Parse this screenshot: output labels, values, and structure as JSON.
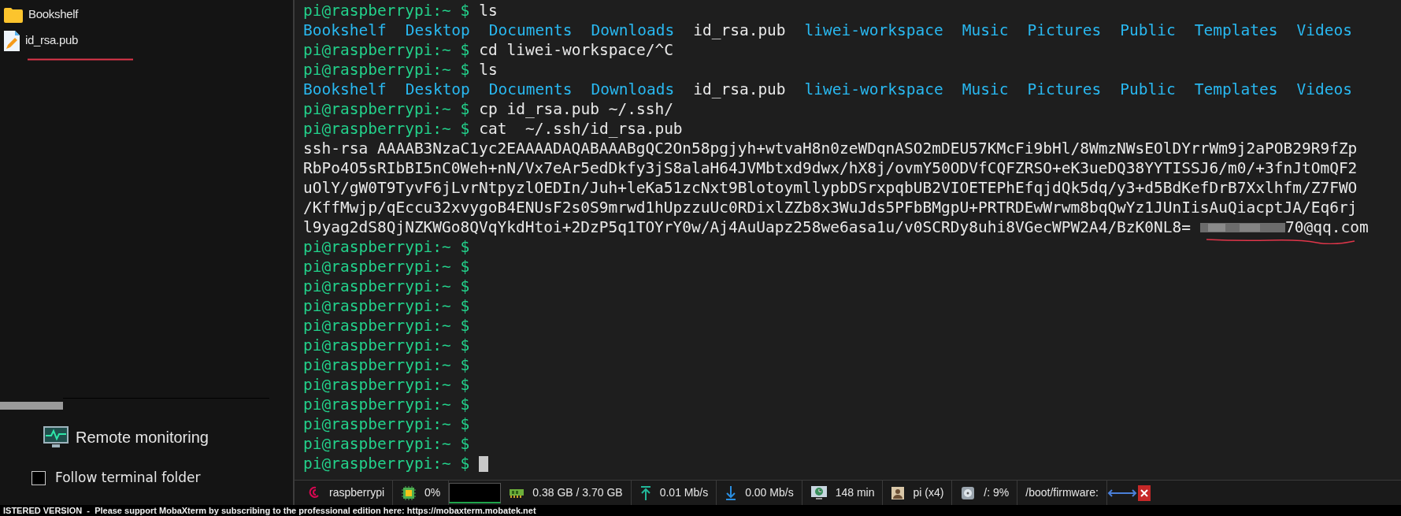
{
  "sidebar": {
    "files": [
      {
        "name": "Bookshelf",
        "kind": "folder"
      },
      {
        "name": "id_rsa.pub",
        "kind": "file"
      }
    ],
    "remote_monitoring": "Remote monitoring",
    "follow_checkbox": {
      "label": "Follow terminal folder",
      "checked": false
    }
  },
  "terminal": {
    "lines": [
      {
        "kind": "command",
        "prompt": "pi@raspberrypi:~ $",
        "text": "ls"
      },
      {
        "kind": "listing",
        "entries": [
          {
            "name": "Bookshelf",
            "kind": "dir"
          },
          {
            "name": "Desktop",
            "kind": "dir"
          },
          {
            "name": "Documents",
            "kind": "dir"
          },
          {
            "name": "Downloads",
            "kind": "dir"
          },
          {
            "name": "id_rsa.pub",
            "kind": "file"
          },
          {
            "name": "liwei-workspace",
            "kind": "dir"
          },
          {
            "name": "Music",
            "kind": "dir"
          },
          {
            "name": "Pictures",
            "kind": "dir"
          },
          {
            "name": "Public",
            "kind": "dir"
          },
          {
            "name": "Templates",
            "kind": "dir"
          },
          {
            "name": "Videos",
            "kind": "dir"
          }
        ]
      },
      {
        "kind": "command",
        "prompt": "pi@raspberrypi:~ $",
        "text": "cd liwei-workspace/^C"
      },
      {
        "kind": "command",
        "prompt": "pi@raspberrypi:~ $",
        "text": "ls"
      },
      {
        "kind": "listing",
        "entries": [
          {
            "name": "Bookshelf",
            "kind": "dir"
          },
          {
            "name": "Desktop",
            "kind": "dir"
          },
          {
            "name": "Documents",
            "kind": "dir"
          },
          {
            "name": "Downloads",
            "kind": "dir"
          },
          {
            "name": "id_rsa.pub",
            "kind": "file"
          },
          {
            "name": "liwei-workspace",
            "kind": "dir"
          },
          {
            "name": "Music",
            "kind": "dir"
          },
          {
            "name": "Pictures",
            "kind": "dir"
          },
          {
            "name": "Public",
            "kind": "dir"
          },
          {
            "name": "Templates",
            "kind": "dir"
          },
          {
            "name": "Videos",
            "kind": "dir"
          }
        ]
      },
      {
        "kind": "command",
        "prompt": "pi@raspberrypi:~ $",
        "text": "cp id_rsa.pub ~/.ssh/"
      },
      {
        "kind": "command",
        "prompt": "pi@raspberrypi:~ $",
        "text": "cat  ~/.ssh/id_rsa.pub"
      },
      {
        "kind": "output",
        "text": "ssh-rsa AAAAB3NzaC1yc2EAAAADAQABAAABgQC2On58pgjyh+wtvaH8n0zeWDqnASO2mDEU57KMcFi9bHl/8WmzNWsEOlDYrrWm9j2aPOB29R9fZp"
      },
      {
        "kind": "output",
        "text": "RbPo4O5sRIbBI5nC0Weh+nN/Vx7eAr5edDkfy3jS8alaH64JVMbtxd9dwx/hX8j/ovmY50ODVfCQFZRSO+eK3ueDQ38YYTISSJ6/m0/+3fnJtOmQF2"
      },
      {
        "kind": "output",
        "text": "uOlY/gW0T9TyvF6jLvrNtpyzlOEDIn/Juh+leKa51zcNxt9BlotoymllypbDSrxpqbUB2VIOETEPhEfqjdQk5dq/y3+d5BdKefDrB7Xxlhfm/Z7FWO"
      },
      {
        "kind": "output",
        "text": "/KffMwjp/qEccu32xvygoB4ENUsF2s0S9mrwd1hUpzzuUc0RDixlZZb8x3WuJds5PFbBMgpU+PRTRDEwWrwm8bqQwYz1JUnIisAuQiacptJA/Eq6rj"
      },
      {
        "kind": "key_end",
        "text": "l9yag2dS8QjNZKWGo8QVqYkdHtoi+2DzP5q1TOYrY0w/Aj4AuUapz258we6asa1u/v0SCRDy8uhi8VGecWPW2A4/BzK0NL8=",
        "email": "70@qq.com"
      },
      {
        "kind": "command",
        "prompt": "pi@raspberrypi:~ $"
      },
      {
        "kind": "command",
        "prompt": "pi@raspberrypi:~ $"
      },
      {
        "kind": "command",
        "prompt": "pi@raspberrypi:~ $"
      },
      {
        "kind": "command",
        "prompt": "pi@raspberrypi:~ $"
      },
      {
        "kind": "command",
        "prompt": "pi@raspberrypi:~ $"
      },
      {
        "kind": "command",
        "prompt": "pi@raspberrypi:~ $"
      },
      {
        "kind": "command",
        "prompt": "pi@raspberrypi:~ $"
      },
      {
        "kind": "command",
        "prompt": "pi@raspberrypi:~ $"
      },
      {
        "kind": "command",
        "prompt": "pi@raspberrypi:~ $"
      },
      {
        "kind": "command",
        "prompt": "pi@raspberrypi:~ $"
      },
      {
        "kind": "command",
        "prompt": "pi@raspberrypi:~ $"
      },
      {
        "kind": "command",
        "prompt": "pi@raspberrypi:~ $",
        "cursor": true
      }
    ]
  },
  "status_bar": [
    {
      "kind": "host",
      "text": "raspberrypi"
    },
    {
      "kind": "cpu",
      "text": "0%"
    },
    {
      "kind": "graph"
    },
    {
      "kind": "memory",
      "text": "0.38 GB / 3.70 GB"
    },
    {
      "kind": "upload",
      "text": "0.01 Mb/s"
    },
    {
      "kind": "download",
      "text": "0.00 Mb/s"
    },
    {
      "kind": "uptime",
      "text": "148 min"
    },
    {
      "kind": "users",
      "text": "pi (x4)"
    },
    {
      "kind": "disk",
      "text": "/: 9%"
    },
    {
      "kind": "mount",
      "text": "/boot/firmware:"
    },
    {
      "kind": "arrows"
    },
    {
      "kind": "close"
    }
  ],
  "banner": "ISTERED VERSION  -  Please support MobaXterm by subscribing to the professional edition here: https://mobaxterm.mobatek.net"
}
